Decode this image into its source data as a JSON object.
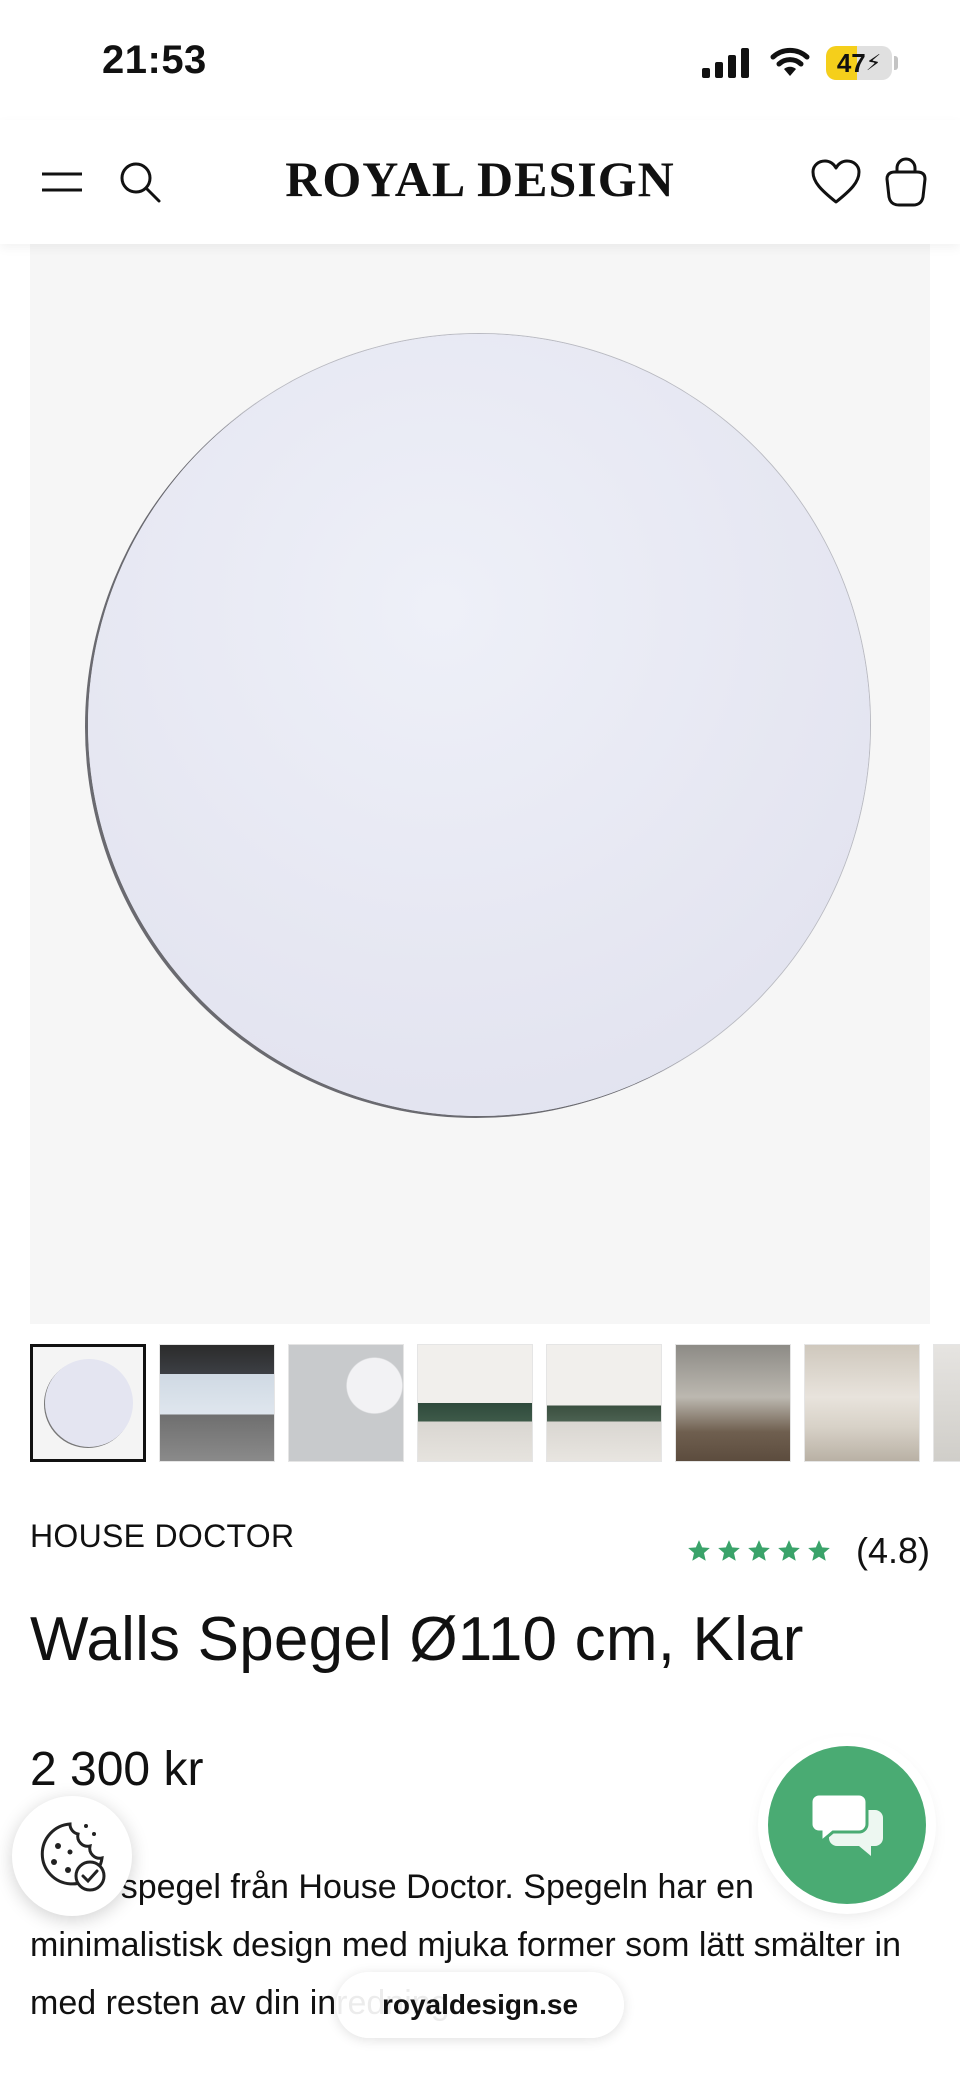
{
  "status_bar": {
    "time": "21:53",
    "battery": "47",
    "battery_level": 0.47
  },
  "header": {
    "brand": "ROYAL DESIGN",
    "icons": [
      "menu-icon",
      "search-icon",
      "heart-icon",
      "bag-icon"
    ]
  },
  "product": {
    "brand": "HOUSE DOCTOR",
    "rating": "(4.8)",
    "stars": 5,
    "title": "Walls Spegel Ø110 cm, Klar",
    "price": "2 300 kr",
    "description": "Rund spegel från House Doctor. Spegeln har en minimalistisk design med mjuka former som lätt smälter in med resten av din inredning.",
    "thumbnail_count": 8
  },
  "browser": {
    "url": "royaldesign.se"
  },
  "colors": {
    "accent_green": "#4aab73",
    "star_green": "#3aa36a",
    "battery_yellow": "#f5cf1b"
  }
}
